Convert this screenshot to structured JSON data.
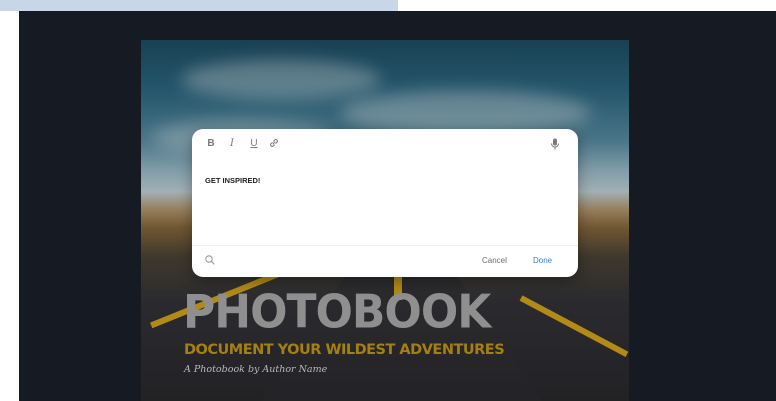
{
  "toolbar": {
    "bold_icon": "bold-icon",
    "italic_icon": "italic-icon",
    "underline_icon": "underline-icon",
    "link_icon": "link-icon",
    "mic_icon": "microphone-icon"
  },
  "editor": {
    "text": "GET INSPIRED!"
  },
  "footer": {
    "search_icon": "search-icon",
    "cancel_label": "Cancel",
    "done_label": "Done"
  },
  "cover": {
    "title": "PHOTOBOOK",
    "subtitle": "DOCUMENT YOUR WILDEST ADVENTURES",
    "byline": "A Photobook by Author Name"
  },
  "colors": {
    "accent": "#3b7ddb",
    "subtitle": "#a5800f",
    "background": "#151a23"
  }
}
